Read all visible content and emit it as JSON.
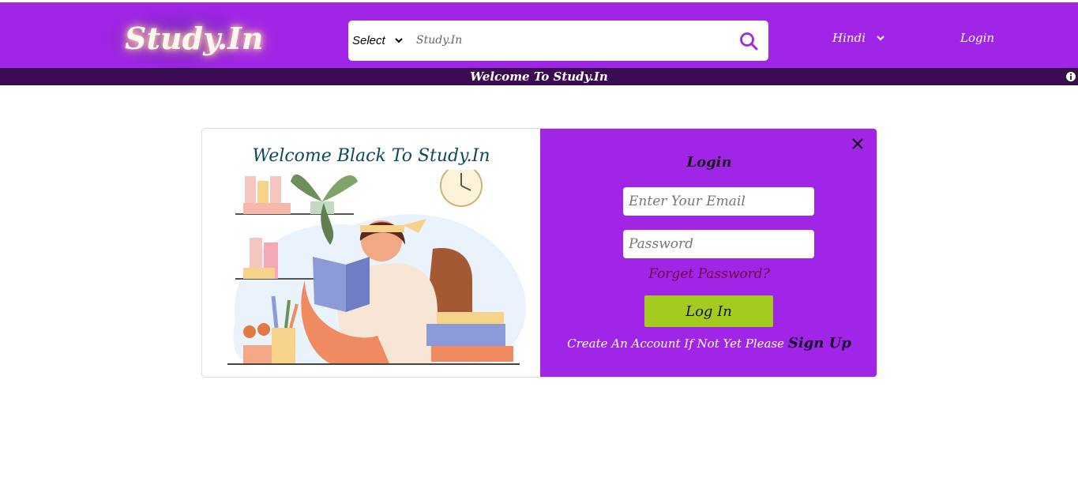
{
  "header": {
    "logo_text": "Study.In",
    "search": {
      "select_label": "Select",
      "placeholder": "Study.In"
    },
    "language": "Hindi",
    "login_label": "Login"
  },
  "ticker": {
    "text": "Welcome To Study.In"
  },
  "modal": {
    "welcome_title": "Welcome Black To Study.In",
    "login_title": "Login",
    "email_placeholder": "Enter Your Email",
    "password_placeholder": "Password",
    "forgot_label": "Forget Password?",
    "login_button": "Log In",
    "signup_prompt": "Create An Account If Not Yet Please",
    "signup_link": "Sign Up"
  },
  "colors": {
    "brand_purple": "#a125e6",
    "ticker_bg": "#3a0a52",
    "login_button": "#a4cb1f",
    "forgot_link": "#7a0046"
  },
  "icons": [
    "chevron-down-icon",
    "search-icon",
    "info-icon",
    "close-icon"
  ]
}
